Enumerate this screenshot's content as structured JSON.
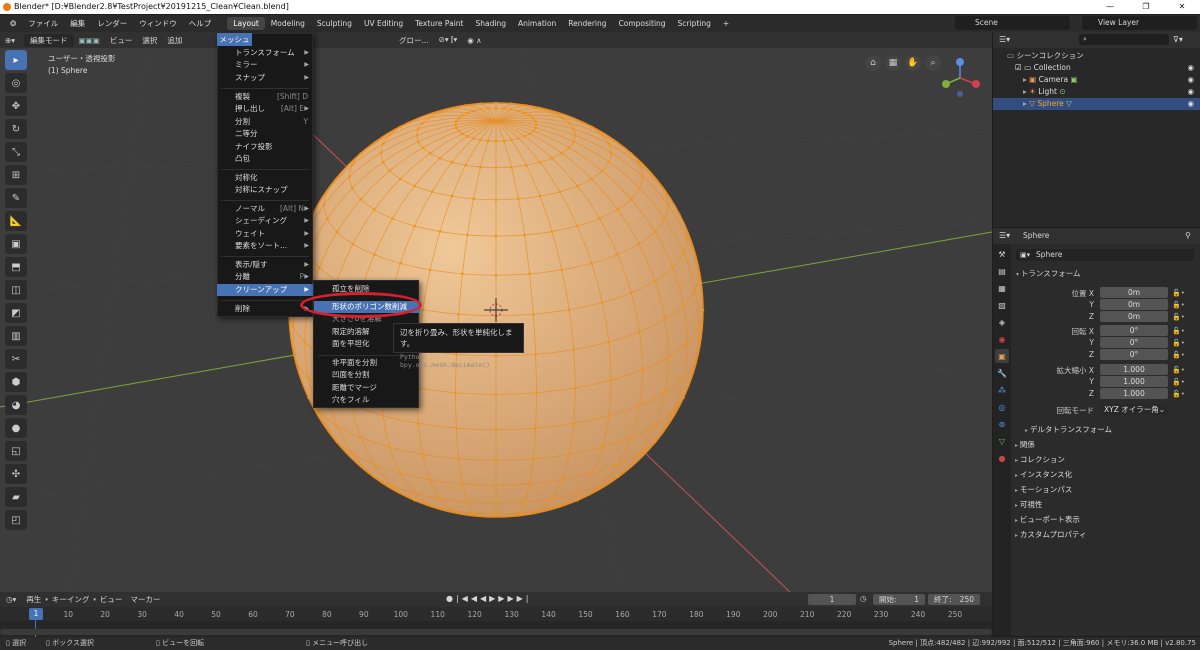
{
  "window": {
    "title": "Blender* [D:¥Blender2.8¥TestProject¥20191215_Clean¥Clean.blend]",
    "controls": [
      "—",
      "❐",
      "✕"
    ]
  },
  "menubar": {
    "items": [
      "ファイル",
      "編集",
      "レンダー",
      "ウィンドウ",
      "ヘルプ"
    ],
    "workspaces": [
      "Layout",
      "Modeling",
      "Sculpting",
      "UV Editing",
      "Texture Paint",
      "Shading",
      "Animation",
      "Rendering",
      "Compositing",
      "Scripting",
      "+"
    ],
    "active_workspace": "Layout",
    "scene": "Scene",
    "view_layer": "View Layer"
  },
  "viewport": {
    "mode": "編集モード",
    "header_menus": [
      "ビュー",
      "選択",
      "追加",
      "メッシュ",
      "頂点",
      "辺",
      "面",
      "UV"
    ],
    "transform_orientation": "グロー...",
    "view_name": "ユーザー・透視投影",
    "selected_object": "(1) Sphere"
  },
  "mesh_menu": {
    "title": "メッシュ",
    "items": [
      {
        "label": "トランスフォーム",
        "shortcut": "",
        "submenu": true
      },
      {
        "label": "ミラー",
        "shortcut": "",
        "submenu": true
      },
      {
        "label": "スナップ",
        "shortcut": "",
        "submenu": true
      },
      {
        "label": "複製",
        "shortcut": "[Shift] D",
        "submenu": false
      },
      {
        "label": "押し出し",
        "shortcut": "[Alt] E",
        "submenu": true
      },
      {
        "label": "分割",
        "shortcut": "Y",
        "submenu": false
      },
      {
        "label": "二等分",
        "shortcut": "",
        "submenu": false
      },
      {
        "label": "ナイフ投影",
        "shortcut": "",
        "submenu": false
      },
      {
        "label": "凸包",
        "shortcut": "",
        "submenu": false
      },
      {
        "label": "対称化",
        "shortcut": "",
        "submenu": false
      },
      {
        "label": "対称にスナップ",
        "shortcut": "",
        "submenu": false
      },
      {
        "label": "ノーマル",
        "shortcut": "[Alt] N",
        "submenu": true
      },
      {
        "label": "シェーディング",
        "shortcut": "",
        "submenu": true
      },
      {
        "label": "ウェイト",
        "shortcut": "",
        "submenu": true
      },
      {
        "label": "要素をソート...",
        "shortcut": "",
        "submenu": true
      },
      {
        "label": "表示/隠す",
        "shortcut": "",
        "submenu": true
      },
      {
        "label": "分離",
        "shortcut": "P",
        "submenu": true
      },
      {
        "label": "クリーンアップ",
        "shortcut": "",
        "submenu": true
      },
      {
        "label": "削除",
        "shortcut": "",
        "submenu": true
      }
    ]
  },
  "cleanup_submenu": {
    "items": [
      "孤立を削除",
      "形状のポリゴン数削減",
      "大きさ0を溶解",
      "限定的溶解",
      "面を平坦化",
      "非平面を分割",
      "凹面を分割",
      "距離でマージ",
      "穴をフィル"
    ]
  },
  "tooltip": {
    "description": "辺を折り畳み、形状を単純化します。",
    "python": "Python: bpy.ops.mesh.decimate()"
  },
  "outliner": {
    "root": "シーンコレクション",
    "collection": "Collection",
    "objects": [
      "Camera",
      "Light",
      "Sphere"
    ],
    "active_object": "Sphere"
  },
  "properties": {
    "object_name": "Sphere",
    "breadcrumb": "Sphere",
    "transform_title": "トランスフォーム",
    "location_label": "位置 X",
    "location": {
      "x": "0m",
      "y": "0m",
      "z": "0m"
    },
    "rotation_label": "回転 X",
    "rotation": {
      "x": "0°",
      "y": "0°",
      "z": "0°"
    },
    "scale_label": "拡大縮小 X",
    "scale": {
      "x": "1.000",
      "y": "1.000",
      "z": "1.000"
    },
    "rotation_mode_label": "回転モード",
    "rotation_mode": "XYZ オイラー角",
    "axis_y": "Y",
    "axis_z": "Z",
    "sections": [
      "デルタトランスフォーム",
      "関係",
      "コレクション",
      "インスタンス化",
      "モーションパス",
      "可視性",
      "ビューポート表示",
      "カスタムプロパティ"
    ]
  },
  "timeline": {
    "menus": [
      "再生",
      "キーイング",
      "ビュー",
      "マーカー"
    ],
    "current_frame": "1",
    "start_label": "開始:",
    "start": "1",
    "end_label": "終了:",
    "end": "250",
    "ticks": [
      "1",
      "10",
      "20",
      "30",
      "40",
      "50",
      "60",
      "70",
      "80",
      "90",
      "100",
      "110",
      "120",
      "130",
      "140",
      "150",
      "160",
      "170",
      "180",
      "190",
      "200",
      "210",
      "220",
      "230",
      "240",
      "250"
    ]
  },
  "statusbar": {
    "left": [
      "選択",
      "ボックス選択",
      "ビューを回転",
      "メニュー呼び出し"
    ],
    "stats": "Sphere | 頂点:482/482 | 辺:992/992 | 面:512/512 | 三角面:960 | メモリ:36.0 MB | v2.80.75"
  },
  "colors": {
    "accent": "#4772b3",
    "mesh_fill": "#e0b07a",
    "mesh_edge": "#e88a1a",
    "highlight_ring": "#d8202c",
    "x_axis": "#c8505a",
    "y_axis": "#7fa33a"
  }
}
